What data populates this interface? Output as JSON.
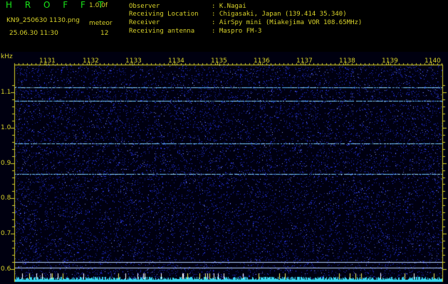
{
  "header": {
    "title": "H R O F F T",
    "version": "1.0.0f",
    "filename": "KN9_250630 1130.png",
    "mode": "meteor",
    "datetime": "25.06.30 11:30",
    "count": "12",
    "info": [
      {
        "key": "Observer",
        "value": ": K.Nagai"
      },
      {
        "key": "Receiving Location",
        "value": ": Chigasaki, Japan (139.414 35.340)"
      },
      {
        "key": "Receiver",
        "value": ": AirSpy mini (Miakejima VOR 108.65MHz)"
      },
      {
        "key": "Receiving antenna",
        "value": ": Maspro FM-3"
      }
    ]
  },
  "spectrogram": {
    "y_unit": "kHz",
    "x_ticks": [
      "1131",
      "1132",
      "1133",
      "1134",
      "1135",
      "1136",
      "1137",
      "1138",
      "1139",
      "1140"
    ],
    "y_ticks": [
      "1.1",
      "1.0",
      "0.9",
      "0.8",
      "0.7",
      "0.6"
    ],
    "colors": {
      "background": "#000010",
      "noise": "#2a3aff",
      "signal": "#9fe0ff",
      "axis": "#d8d22a",
      "ticks": "#d8d22a"
    },
    "carriers_khz": [
      1.115,
      1.075,
      0.955,
      0.87,
      0.62,
      0.605
    ]
  }
}
